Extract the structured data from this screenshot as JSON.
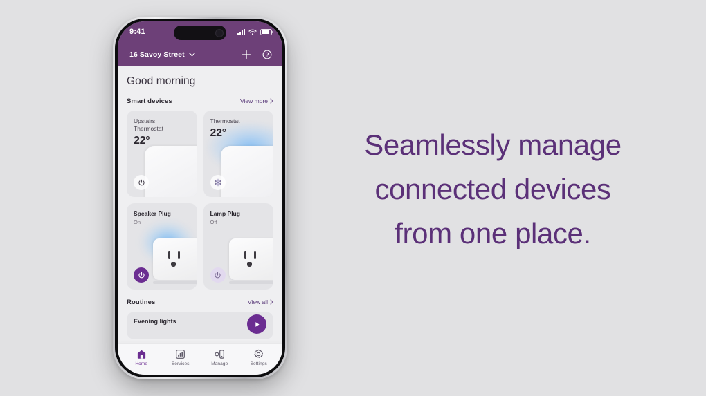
{
  "slide": {
    "background_color": "#e1e1e3",
    "headline_color": "#5b3078",
    "headline_lines": [
      "Seamlessly manage",
      "connected devices",
      "from one place."
    ]
  },
  "phone": {
    "status_bar": {
      "time": "9:41",
      "signal_icon": "cellular-signal-icon",
      "wifi_icon": "wifi-icon",
      "battery_icon": "battery-icon",
      "background_color": "#6d4078"
    },
    "app_bar": {
      "address": "16 Savoy Street",
      "dropdown_icon": "chevron-down-icon",
      "add_icon": "plus-icon",
      "help_icon": "help-circle-icon"
    },
    "content": {
      "greeting": "Good morning",
      "smart_devices": {
        "title": "Smart devices",
        "link_label": "View more",
        "link_icon": "chevron-right-icon",
        "cards": [
          {
            "name": "Upstairs\nThermostat",
            "name_line1": "Upstairs",
            "name_line2": "Thermostat",
            "temperature": "22°",
            "control_icon": "power-icon",
            "control_state": "ghost",
            "art": "thermostat"
          },
          {
            "name_line1": "Thermostat",
            "name_line2": "",
            "temperature": "22°",
            "control_icon": "snowflake-icon",
            "control_state": "ghost",
            "art": "thermostat-glow"
          }
        ],
        "plugs": [
          {
            "name": "Speaker Plug",
            "status": "On",
            "control_icon": "power-icon",
            "control_state": "on",
            "accent_color": "#6b2d91"
          },
          {
            "name": "Lamp Plug",
            "status": "Off",
            "control_icon": "power-icon",
            "control_state": "off",
            "accent_color": "#e2d9ef"
          }
        ]
      },
      "routines": {
        "title": "Routines",
        "link_label": "View all",
        "link_icon": "chevron-right-icon",
        "items": [
          {
            "name": "Evening lights",
            "play_icon": "play-icon"
          }
        ]
      }
    },
    "tab_bar": {
      "active_color": "#6b2d91",
      "tabs": [
        {
          "label": "Home",
          "icon": "home-icon",
          "active": true
        },
        {
          "label": "Services",
          "icon": "chart-icon",
          "active": false
        },
        {
          "label": "Manage",
          "icon": "devices-icon",
          "active": false
        },
        {
          "label": "Settings",
          "icon": "gear-icon",
          "active": false
        }
      ]
    }
  }
}
